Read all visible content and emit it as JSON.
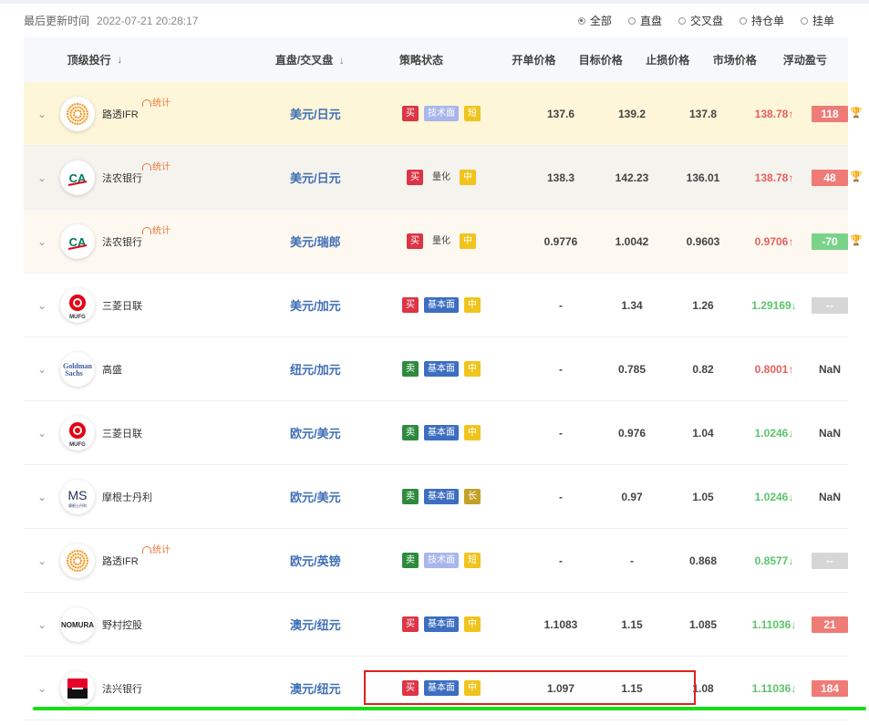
{
  "header": {
    "updated_label": "最后更新时间",
    "updated_time": "2022-07-21 20:28:17",
    "filters": [
      {
        "label": "全部",
        "selected": true
      },
      {
        "label": "直盘",
        "selected": false
      },
      {
        "label": "交叉盘",
        "selected": false
      },
      {
        "label": "持仓单",
        "selected": false
      },
      {
        "label": "挂单",
        "selected": false
      }
    ]
  },
  "table": {
    "columns": {
      "bank": "顶级投行",
      "bank_sort": "↓",
      "pair": "直盘/交叉盘",
      "pair_sort": "↓",
      "strategy": "策略状态",
      "open": "开单价格",
      "target": "目标价格",
      "stop": "止损价格",
      "market": "市场价格",
      "pnl": "浮动盈亏"
    },
    "stat_label": "统计",
    "rows": [
      {
        "bank": "路透IFR",
        "logo": "reuters-logo",
        "stat": true,
        "pair": "美元/日元",
        "side": "买",
        "type": "技术面",
        "horizon": "短",
        "open": "137.6",
        "target": "139.2",
        "stop": "137.8",
        "market": "138.78",
        "dir": "↑",
        "pnl": "118"
      },
      {
        "bank": "法农银行",
        "logo": "credit-agricole-logo",
        "stat": true,
        "pair": "美元/日元",
        "side": "买",
        "type": "量化",
        "horizon": "中",
        "open": "138.3",
        "target": "142.23",
        "stop": "136.01",
        "market": "138.78",
        "dir": "↑",
        "pnl": "48"
      },
      {
        "bank": "法农银行",
        "logo": "credit-agricole-logo",
        "stat": true,
        "pair": "美元/瑞郎",
        "side": "买",
        "type": "量化",
        "horizon": "中",
        "open": "0.9776",
        "target": "1.0042",
        "stop": "0.9603",
        "market": "0.9706",
        "dir": "↑",
        "pnl": "-70"
      },
      {
        "bank": "三菱日联",
        "logo": "mufg-logo",
        "stat": false,
        "pair": "美元/加元",
        "side": "买",
        "type": "基本面",
        "horizon": "中",
        "open": "-",
        "target": "1.34",
        "stop": "1.26",
        "market": "1.29169",
        "dir": "↓",
        "pnl": "--"
      },
      {
        "bank": "高盛",
        "logo": "goldman-sachs-logo",
        "stat": false,
        "pair": "纽元/加元",
        "side": "卖",
        "type": "基本面",
        "horizon": "中",
        "open": "-",
        "target": "0.785",
        "stop": "0.82",
        "market": "0.8001",
        "dir": "↑",
        "pnl": "NaN"
      },
      {
        "bank": "三菱日联",
        "logo": "mufg-logo",
        "stat": false,
        "pair": "欧元/美元",
        "side": "卖",
        "type": "基本面",
        "horizon": "中",
        "open": "-",
        "target": "0.976",
        "stop": "1.04",
        "market": "1.0246",
        "dir": "↓",
        "pnl": "NaN"
      },
      {
        "bank": "摩根士丹利",
        "logo": "morgan-stanley-logo",
        "stat": false,
        "pair": "欧元/美元",
        "side": "卖",
        "type": "基本面",
        "horizon": "长",
        "open": "-",
        "target": "0.97",
        "stop": "1.05",
        "market": "1.0246",
        "dir": "↓",
        "pnl": "NaN"
      },
      {
        "bank": "路透IFR",
        "logo": "reuters-logo",
        "stat": true,
        "pair": "欧元/英镑",
        "side": "卖",
        "type": "技术面",
        "horizon": "短",
        "open": "-",
        "target": "-",
        "stop": "0.868",
        "market": "0.8577",
        "dir": "↓",
        "pnl": "--"
      },
      {
        "bank": "野村控股",
        "logo": "nomura-logo",
        "stat": false,
        "pair": "澳元/纽元",
        "side": "买",
        "type": "基本面",
        "horizon": "中",
        "open": "1.1083",
        "target": "1.15",
        "stop": "1.085",
        "market": "1.11036",
        "dir": "↓",
        "pnl": "21"
      },
      {
        "bank": "法兴银行",
        "logo": "societe-generale-logo",
        "stat": false,
        "pair": "澳元/纽元",
        "side": "买",
        "type": "基本面",
        "horizon": "中",
        "open": "1.097",
        "target": "1.15",
        "stop": "1.08",
        "market": "1.11036",
        "dir": "↓",
        "pnl": "184"
      }
    ]
  },
  "logos": {
    "goldman_line1": "Goldman",
    "goldman_line2": "Sachs",
    "ms_text": "MS",
    "ms_sub": "摩根士丹利",
    "mufg_text": "MUFG",
    "nomura_text": "NOMURA"
  },
  "colors": {
    "buy": "#dc3545",
    "sell": "#2e8b3e",
    "up": "#e8605a",
    "down": "#5cc46b",
    "pair": "#3f6fb5"
  }
}
